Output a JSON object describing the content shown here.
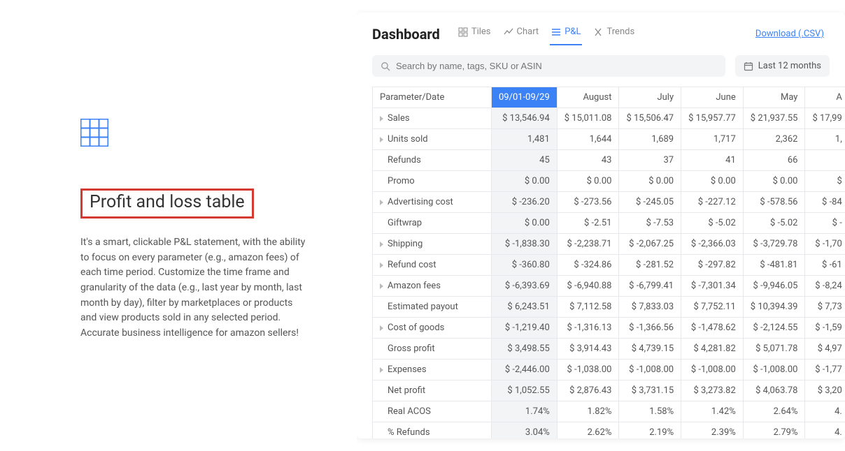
{
  "left": {
    "heading": "Profit and loss table",
    "description": "It's a smart, clickable P&L statement, with the ability to focus on every parameter (e.g., amazon fees) of each time period. Customize the time frame and granularity of the data (e.g., last year by month, last month by day), filter by marketplaces or products and view products sold in any selected period. Accurate business intelligence for amazon sellers!"
  },
  "panel": {
    "title": "Dashboard",
    "tabs": {
      "tiles": "Tiles",
      "chart": "Chart",
      "pnl": "P&L",
      "trends": "Trends"
    },
    "download": "Download (.CSV)",
    "search_placeholder": "Search by name, tags, SKU or ASIN",
    "period_label": "Last 12 months"
  },
  "table": {
    "header": {
      "param": "Parameter/Date",
      "cols": [
        "09/01-09/29",
        "August",
        "July",
        "June",
        "May",
        "A"
      ]
    },
    "rows": [
      {
        "label": "Sales",
        "expandable": true,
        "values": [
          "$ 13,546.94",
          "$ 15,011.08",
          "$ 15,506.47",
          "$ 15,957.77",
          "$ 21,937.55",
          "$ 17,99"
        ]
      },
      {
        "label": "Units sold",
        "expandable": true,
        "values": [
          "1,481",
          "1,644",
          "1,689",
          "1,717",
          "2,362",
          "1,"
        ]
      },
      {
        "label": "Refunds",
        "expandable": false,
        "values": [
          "45",
          "43",
          "37",
          "41",
          "66",
          ""
        ]
      },
      {
        "label": "Promo",
        "expandable": false,
        "values": [
          "$ 0.00",
          "$ 0.00",
          "$ 0.00",
          "$ 0.00",
          "$ 0.00",
          "$ "
        ]
      },
      {
        "label": "Advertising cost",
        "expandable": true,
        "values": [
          "$ -236.20",
          "$ -273.56",
          "$ -245.05",
          "$ -227.12",
          "$ -578.56",
          "$ -84"
        ]
      },
      {
        "label": "Giftwrap",
        "expandable": false,
        "values": [
          "$ 0.00",
          "$ -2.51",
          "$ -7.53",
          "$ -5.02",
          "$ -5.02",
          "$ -"
        ]
      },
      {
        "label": "Shipping",
        "expandable": true,
        "values": [
          "$ -1,838.30",
          "$ -2,238.71",
          "$ -2,067.25",
          "$ -2,366.03",
          "$ -3,729.78",
          "$ -1,70"
        ]
      },
      {
        "label": "Refund cost",
        "expandable": true,
        "values": [
          "$ -360.80",
          "$ -324.86",
          "$ -281.52",
          "$ -297.82",
          "$ -481.81",
          "$ -61"
        ]
      },
      {
        "label": "Amazon fees",
        "expandable": true,
        "values": [
          "$ -6,393.69",
          "$ -6,940.88",
          "$ -6,799.41",
          "$ -7,301.34",
          "$ -9,946.05",
          "$ -8,24"
        ]
      },
      {
        "label": "Estimated payout",
        "expandable": false,
        "values": [
          "$ 6,243.51",
          "$ 7,112.58",
          "$ 7,833.03",
          "$ 7,752.11",
          "$ 10,394.39",
          "$ 7,73"
        ]
      },
      {
        "label": "Cost of goods",
        "expandable": true,
        "values": [
          "$ -1,219.40",
          "$ -1,316.13",
          "$ -1,366.56",
          "$ -1,478.62",
          "$ -2,124.55",
          "$ -1,59"
        ]
      },
      {
        "label": "Gross profit",
        "expandable": false,
        "values": [
          "$ 3,498.55",
          "$ 3,914.43",
          "$ 4,739.15",
          "$ 4,281.82",
          "$ 5,071.78",
          "$ 4,97"
        ]
      },
      {
        "label": "Expenses",
        "expandable": true,
        "values": [
          "$ -2,446.00",
          "$ -1,038.00",
          "$ -1,008.00",
          "$ -1,008.00",
          "$ -1,008.00",
          "$ -1,77"
        ]
      },
      {
        "label": "Net profit",
        "expandable": false,
        "values": [
          "$ 1,052.55",
          "$ 2,876.43",
          "$ 3,731.15",
          "$ 3,273.82",
          "$ 4,063.78",
          "$ 3,20"
        ]
      },
      {
        "label": "Real ACOS",
        "expandable": false,
        "values": [
          "1.74%",
          "1.82%",
          "1.58%",
          "1.42%",
          "2.64%",
          "4."
        ]
      },
      {
        "label": "% Refunds",
        "expandable": false,
        "values": [
          "3.04%",
          "2.62%",
          "2.19%",
          "2.39%",
          "2.79%",
          "4."
        ]
      }
    ]
  }
}
